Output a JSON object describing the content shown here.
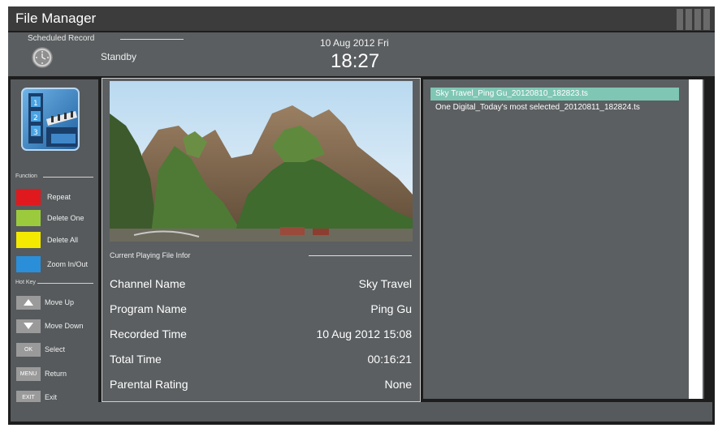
{
  "window": {
    "title": "File Manager"
  },
  "header": {
    "scheduled_record_label": "Scheduled Record",
    "status": "Standby",
    "date": "10 Aug 2012 Fri",
    "time": "18:27"
  },
  "sidebar": {
    "function_label": "Function",
    "functions": [
      {
        "label": "Repeat",
        "color": "#e0191e"
      },
      {
        "label": "Delete One",
        "color": "#9bcb3c"
      },
      {
        "label": "Delete All",
        "color": "#f4ea00"
      },
      {
        "label": "Zoom In/Out",
        "color": "#2a8fd8"
      }
    ],
    "hotkey_label": "Hot Key",
    "hotkeys": [
      {
        "key_icon": "up-arrow-icon",
        "label": "Move Up"
      },
      {
        "key_icon": "down-arrow-icon",
        "label": "Move Down"
      },
      {
        "key": "OK",
        "label": "Select"
      },
      {
        "key": "MENU",
        "label": "Return"
      },
      {
        "key": "EXIT",
        "label": "Exit"
      }
    ]
  },
  "playing": {
    "section_title": "Current Playing File Infor",
    "fields": [
      {
        "label": "Channel Name",
        "value": "Sky Travel"
      },
      {
        "label": "Program Name",
        "value": "Ping Gu"
      },
      {
        "label": "Recorded Time",
        "value": "10 Aug 2012 15:08"
      },
      {
        "label": "Total Time",
        "value": "00:16:21"
      },
      {
        "label": "Parental Rating",
        "value": "None"
      }
    ]
  },
  "files": {
    "items": [
      {
        "name": "Sky Travel_Ping Gu_20120810_182823.ts",
        "selected": true
      },
      {
        "name": "One Digital_Today's most selected_20120811_182824.ts",
        "selected": false
      }
    ]
  },
  "colors": {
    "selection": "#7fc6b4",
    "panel": "#5b5f61"
  }
}
